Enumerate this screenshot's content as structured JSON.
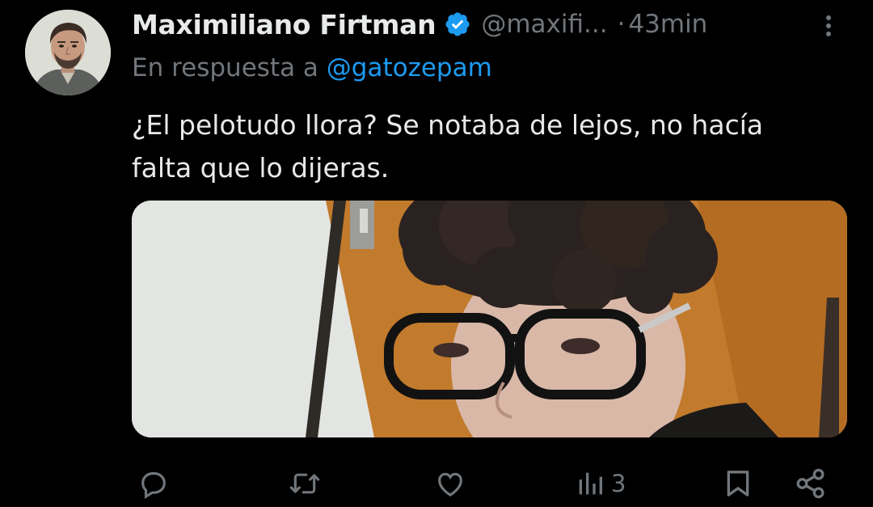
{
  "author": {
    "display_name": "Maximiliano Firtman",
    "handle": "@maxifi...",
    "separator": "·",
    "time": "43min",
    "verified": true
  },
  "reply": {
    "prefix": "En respuesta a",
    "mention": "@gatozepam"
  },
  "tweet": {
    "text": "¿El pelotudo llora? Se notaba de lejos, no hacía falta que lo dijeras."
  },
  "media": {
    "description_icon": "photo-attachment"
  },
  "actions": {
    "reply_icon": "reply-icon",
    "retweet_icon": "retweet-icon",
    "like_icon": "like-icon",
    "views_icon": "views-icon",
    "views_count": "3",
    "bookmark_icon": "bookmark-icon",
    "share_icon": "share-icon"
  },
  "colors": {
    "background": "#000000",
    "text_primary": "#e7e9ea",
    "text_secondary": "#71767b",
    "link": "#1d9bf0",
    "verified_badge": "#1d9bf0"
  }
}
